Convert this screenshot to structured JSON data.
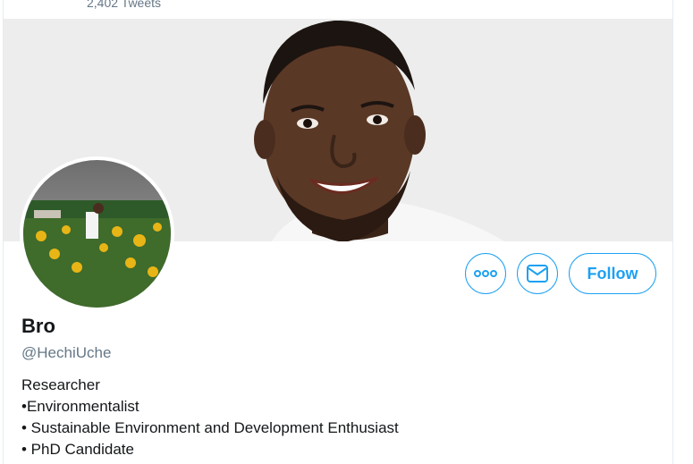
{
  "header": {
    "tweet_count": "2,402 Tweets"
  },
  "profile": {
    "name": "Bro",
    "handle": "@HechiUche",
    "bio_lines": [
      "Researcher",
      "•Environmentalist",
      "• Sustainable Environment and Development Enthusiast",
      "• PhD Candidate"
    ]
  },
  "actions": {
    "more_icon": "more-options-icon",
    "message_icon": "envelope-icon",
    "follow_label": "Follow"
  },
  "colors": {
    "accent": "#1da1f2",
    "banner_bg": "#ededed",
    "secondary_text": "#657786"
  }
}
